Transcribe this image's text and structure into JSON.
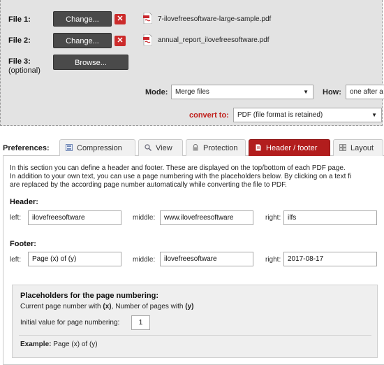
{
  "files": [
    {
      "label": "File 1:",
      "button": "Change...",
      "name": "7-ilovefreesoftware-large-sample.pdf"
    },
    {
      "label": "File 2:",
      "button": "Change...",
      "name": "annual_report_ilovefreesoftware.pdf"
    }
  ],
  "file3": {
    "label": "File 3:",
    "sub": "(optional)",
    "button": "Browse..."
  },
  "mode": {
    "label": "Mode:",
    "value": "Merge files",
    "how_label": "How:",
    "how_value": "one after a"
  },
  "convert": {
    "label": "convert to:",
    "value": "PDF (file format is retained)"
  },
  "preferences": {
    "label": "Preferences:",
    "tabs": [
      {
        "label": "Compression",
        "icon": "compression-icon"
      },
      {
        "label": "View",
        "icon": "view-icon"
      },
      {
        "label": "Protection",
        "icon": "lock-icon"
      },
      {
        "label": "Header / footer",
        "icon": "document-icon",
        "active": true
      },
      {
        "label": "Layout",
        "icon": "layout-grid-icon"
      }
    ]
  },
  "intro": [
    "In this section you can define a header and footer. These are displayed on the top/bottom of each PDF page.",
    "In addition to your own text, you can use a page numbering with the placeholders below. By clicking on a text fi",
    "are replaced by the according page number automatically while converting the file to PDF."
  ],
  "header": {
    "title": "Header:",
    "left_label": "left:",
    "left": "ilovefreesoftware",
    "middle_label": "middle:",
    "middle": "www.ilovefreesoftware",
    "right_label": "right:",
    "right": "ilfs"
  },
  "footer": {
    "title": "Footer:",
    "left_label": "left:",
    "left": "Page (x) of (y)",
    "middle_label": "middle:",
    "middle": "ilovefreesoftware",
    "right_label": "right:",
    "right": "2017-08-17"
  },
  "placeholders": {
    "title": "Placeholders for the page numbering:",
    "current_prefix": "Current page number with ",
    "current_token": "(x)",
    "count_prefix": ", Number of pages with ",
    "count_token": "(y)",
    "initial_label": "Initial value for page numbering:",
    "initial_value": "1",
    "example_label": "Example:",
    "example_value": "Page (x) of (y)"
  },
  "colors": {
    "accent": "#b21d1d",
    "convert_label": "#c0211d",
    "button_dark": "#4a4a4a",
    "delete": "#cc2b2b"
  }
}
